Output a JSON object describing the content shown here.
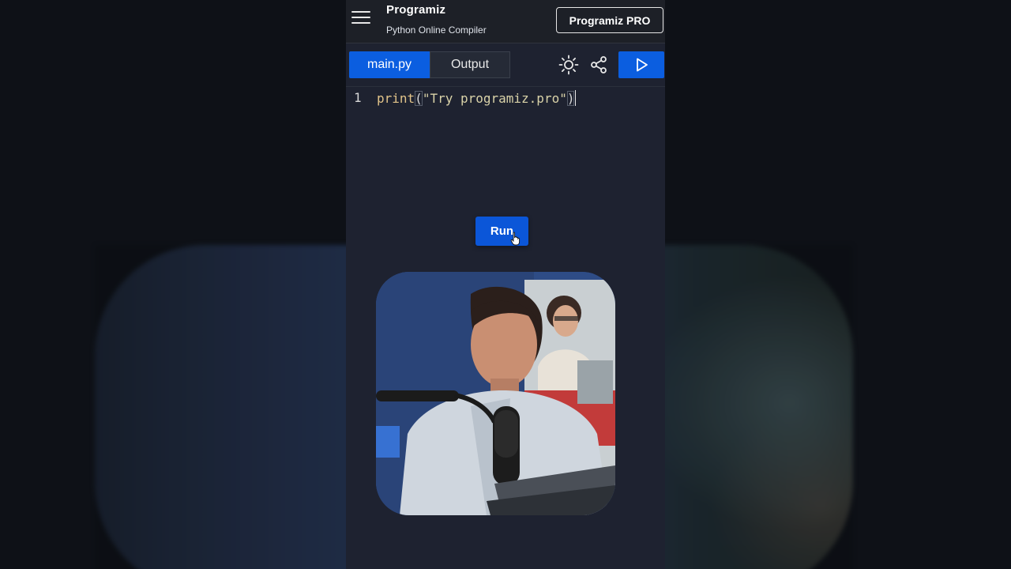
{
  "header": {
    "logo_text": "Programiz",
    "subtitle": "Python Online Compiler",
    "pro_button": "Programiz PRO"
  },
  "toolbar": {
    "tabs": [
      {
        "label": "main.py",
        "active": true
      },
      {
        "label": "Output",
        "active": false
      }
    ],
    "icons": [
      "sun-theme-icon",
      "share-icon",
      "play-icon"
    ]
  },
  "editor": {
    "line_number": "1",
    "code_fn": "print",
    "code_open": "(",
    "code_string": "\"Try programiz.pro\"",
    "code_close": ")"
  },
  "run_button": {
    "label": "Run"
  },
  "colors": {
    "accent": "#0b5ee0",
    "background": "#1e2230",
    "header": "#1d2027"
  }
}
